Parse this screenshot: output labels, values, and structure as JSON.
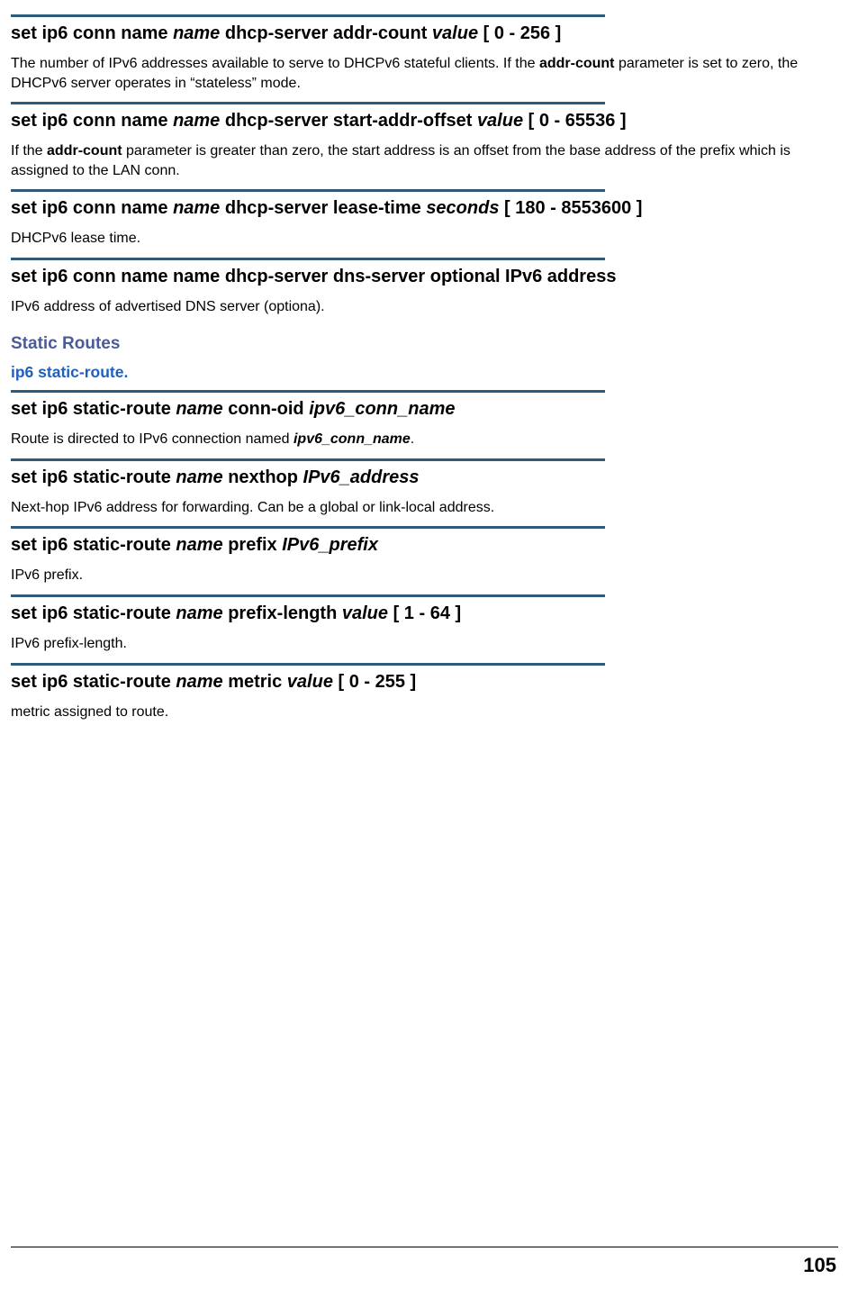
{
  "commands": [
    {
      "title_parts": {
        "p1": "set ip6 conn name ",
        "i1": "name",
        "p2": " dhcp-server  addr-count ",
        "i2": "value",
        "p3": " [ 0 - 256 ]"
      },
      "desc": {
        "t1": "The number of IPv6 addresses available to serve to DHCPv6 stateful clients. If the ",
        "b1": "addr-count",
        "t2": " parameter is set to zero, the DHCPv6 server operates in “stateless” mode."
      }
    },
    {
      "title_parts": {
        "p1": "set ip6 conn name ",
        "i1": "name",
        "p2": " dhcp-server  start-addr-offset ",
        "i2": "value",
        "p3": " [ 0 - 65536 ]"
      },
      "desc": {
        "t1": "If the ",
        "b1": "addr-count",
        "t2": " parameter is greater than zero, the start address is an offset from the base address of the prefix which is assigned to the LAN conn."
      }
    },
    {
      "title_parts": {
        "p1": "set ip6 conn name ",
        "i1": "name",
        "p2": " dhcp-server  lease-time ",
        "i2": "seconds",
        "p3": " [ 180 - 8553600 ]"
      },
      "desc": {
        "t1": "DHCPv6 lease time."
      }
    },
    {
      "title_parts": {
        "p1": "set ip6 conn name name dhcp-server  dns-server optional IPv6 address"
      },
      "desc": {
        "t1": "IPv6 address of advertised DNS server (optiona)."
      }
    }
  ],
  "section": {
    "title": "Static Routes",
    "subtitle": "ip6 static-route."
  },
  "routes": [
    {
      "title_parts": {
        "p1": "set ip6 static-route ",
        "i1": "name",
        "p2": " conn-oid ",
        "i2": "ipv6_conn_name"
      },
      "desc": {
        "t1": "Route is directed to IPv6 connection named ",
        "bi1": "ipv6_conn_name",
        "t2": "."
      }
    },
    {
      "title_parts": {
        "p1": "set ip6 static-route ",
        "i1": "name",
        "p2": " nexthop ",
        "i2": "IPv6_address"
      },
      "desc": {
        "t1": "Next-hop IPv6 address for forwarding. Can be a global or link-local address."
      }
    },
    {
      "title_parts": {
        "p1": "set ip6 static-route ",
        "i1": "name",
        "p2": " prefix ",
        "i2": "IPv6_prefix"
      },
      "desc": {
        "t1": "IPv6 prefix."
      }
    },
    {
      "title_parts": {
        "p1": "set ip6 static-route ",
        "i1": "name",
        "p2": " prefix-length ",
        "i2": "value",
        "p3": " [ 1 - 64 ]"
      },
      "desc": {
        "t1": "IPv6 prefix-length."
      }
    },
    {
      "title_parts": {
        "p1": "set ip6 static-route ",
        "i1": "name",
        "p2": " metric ",
        "i2": "value",
        "p3": " [ 0 - 255 ]"
      },
      "desc": {
        "t1": "metric assigned to route."
      }
    }
  ],
  "page_number": "105"
}
